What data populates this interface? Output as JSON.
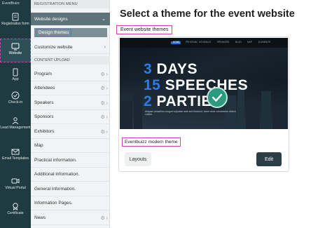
{
  "app": {
    "brand": "EventBuizz"
  },
  "rail": {
    "items": [
      {
        "label": "Registration form",
        "icon": "registration-icon"
      },
      {
        "label": "Website",
        "icon": "website-icon",
        "active": true
      },
      {
        "label": "App",
        "icon": "app-icon"
      },
      {
        "label": "Check-in",
        "icon": "check-in-icon"
      },
      {
        "label": "Lead Management",
        "icon": "lead-management-icon"
      },
      {
        "label": "Email Templates",
        "icon": "email-templates-icon"
      },
      {
        "label": "Virtual Portal",
        "icon": "virtual-portal-icon"
      },
      {
        "label": "Certificate",
        "icon": "certificate-icon"
      }
    ]
  },
  "menu": {
    "registration_header": "REGISTRATION MENU",
    "website_designs": "Website designs",
    "design_themes": "Design themes",
    "customize_website": "Customize website",
    "content_upload_header": "CONTENT UPLOAD",
    "items": [
      "Program",
      "Attendees",
      "Speakers",
      "Sponsors",
      "Exhibitors",
      "Map",
      "Practical information.",
      "Additional information.",
      "General information.",
      "Information Pages.",
      "News"
    ]
  },
  "main": {
    "title": "Select a theme for the event website",
    "section_label": "Event website themes",
    "theme": {
      "name": "Eventbuizz modern theme",
      "layouts_label": "Layouts",
      "edit_label": "Edit",
      "preview": {
        "nav": [
          "HOME",
          "PROGRAM",
          "SCHEDULE",
          "SPEAKERS",
          "BLOG",
          "MAP",
          "ELEMENTS"
        ],
        "line1_num": "3",
        "line1_text": "DAYS",
        "line2_num": "15",
        "line2_text": "SPEECHES",
        "line3_num": "2",
        "line3_text": "PARTIES",
        "blurb": "Aliquam phasellus congue vulputate ante sed tincidunt, lorem dolor consectetur dictum cubilia."
      }
    }
  },
  "colors": {
    "rail_bg": "#1f3a40",
    "accent": "#2e7be6",
    "highlight": "#d040b0",
    "edit_bg": "#2c3e45"
  }
}
